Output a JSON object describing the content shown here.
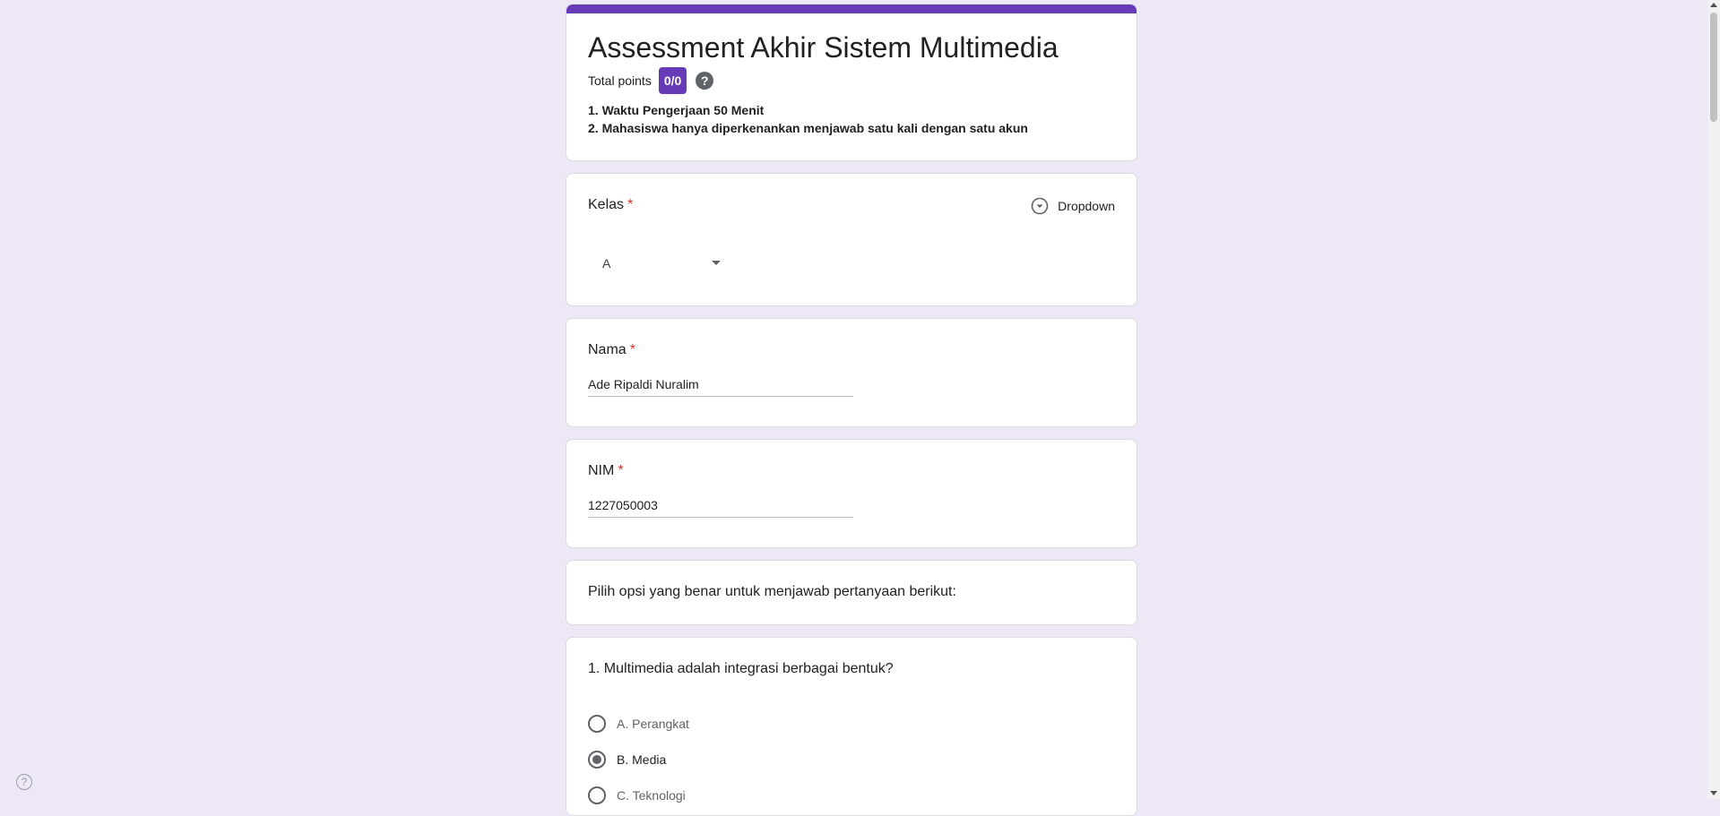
{
  "form": {
    "title": "Assessment Akhir Sistem Multimedia",
    "total_points_label": "Total points",
    "points_badge": "0/0",
    "help_symbol": "?",
    "description_lines": [
      "1. Waktu Pengerjaan 50 Menit",
      "2. Mahasiswa hanya diperkenankan menjawab satu kali dengan satu akun"
    ],
    "accent_color": "#673ab7",
    "background_color": "#ede7f6"
  },
  "kelas": {
    "label": "Kelas",
    "required_mark": "*",
    "type_label": "Dropdown",
    "selected_value": "A"
  },
  "nama": {
    "label": "Nama",
    "required_mark": "*",
    "value": "Ade Ripaldi Nuralim"
  },
  "nim": {
    "label": "NIM",
    "required_mark": "*",
    "value": "1227050003"
  },
  "section": {
    "text": "Pilih opsi yang benar untuk menjawab pertanyaan berikut:"
  },
  "question1": {
    "title": "1. Multimedia adalah integrasi berbagai bentuk?",
    "options": [
      "A. Perangkat",
      "B. Media",
      "C. Teknologi"
    ],
    "selected_index": 1
  },
  "corner_help": {
    "symbol": "?",
    "icon": "help-circle-icon"
  }
}
